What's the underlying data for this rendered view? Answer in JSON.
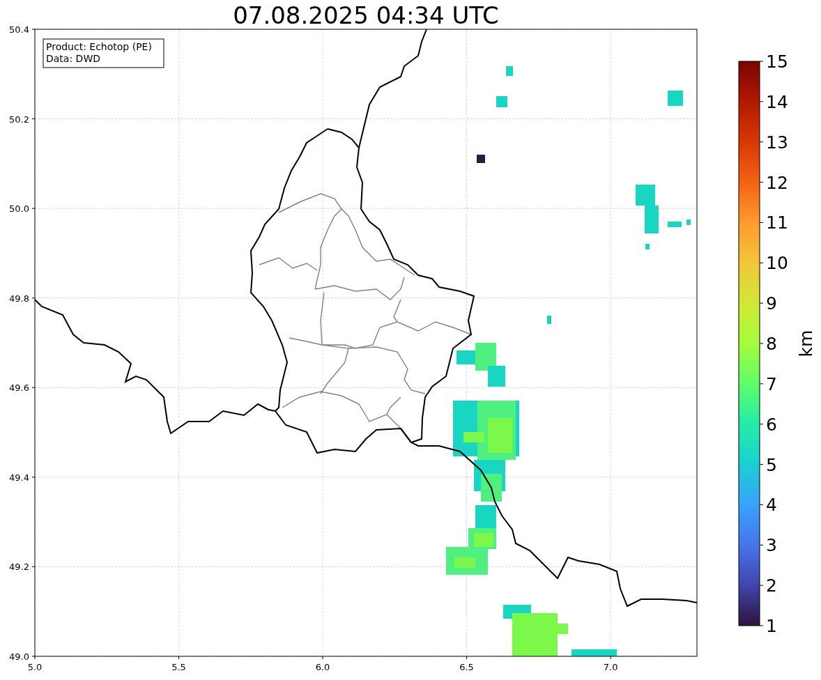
{
  "title": "07.08.2025 04:34 UTC",
  "legend": [
    "Product: Echotop (PE)",
    "Data: DWD"
  ],
  "x_axis": {
    "ticks": [
      "5.0",
      "5.5",
      "6.0",
      "6.5",
      "7.0"
    ]
  },
  "y_axis": {
    "ticks": [
      "50.4",
      "50.2",
      "50.0",
      "49.8",
      "49.6",
      "49.4",
      "49.2",
      "49.0"
    ]
  },
  "colorbar": {
    "label": "km",
    "ticks": [
      "15",
      "14",
      "13",
      "12",
      "11",
      "10",
      "9",
      "8",
      "7",
      "6",
      "5",
      "4",
      "3",
      "2",
      "1"
    ]
  }
}
